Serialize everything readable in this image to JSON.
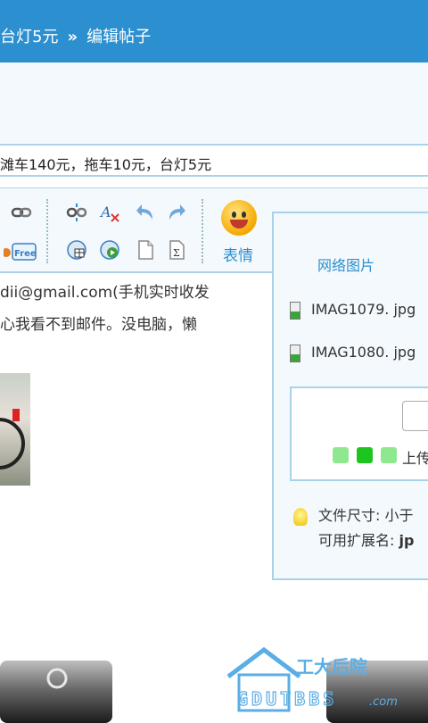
{
  "header": {
    "crumb_prev": "台灯5元",
    "separator": "»",
    "crumb_current": "编辑帖子"
  },
  "subject": {
    "value": "滩车140元，拖车10元，台灯5元"
  },
  "toolbar": {
    "emoji_label": "表情",
    "free_label": "Free"
  },
  "content": {
    "line1": "dii@gmail.com(手机实时收发",
    "line2": "心我看不到邮件。没电脑，懒"
  },
  "attach_panel": {
    "title": "网络图片",
    "files": [
      "IMAG1079. jpg",
      "IMAG1080. jpg"
    ],
    "upload_label": "上传",
    "size_label": "文件尺寸: 小于",
    "ext_label": "可用扩展名:",
    "ext_value": "jp"
  },
  "watermark": {
    "cn": "工大后院",
    "en": "GDUTBBS",
    "suffix": ".com"
  },
  "colors": {
    "header": "#2c8fcf",
    "border": "#a9d2ea",
    "progress_light": "#8fe88f",
    "progress_dark": "#1ec51e"
  }
}
